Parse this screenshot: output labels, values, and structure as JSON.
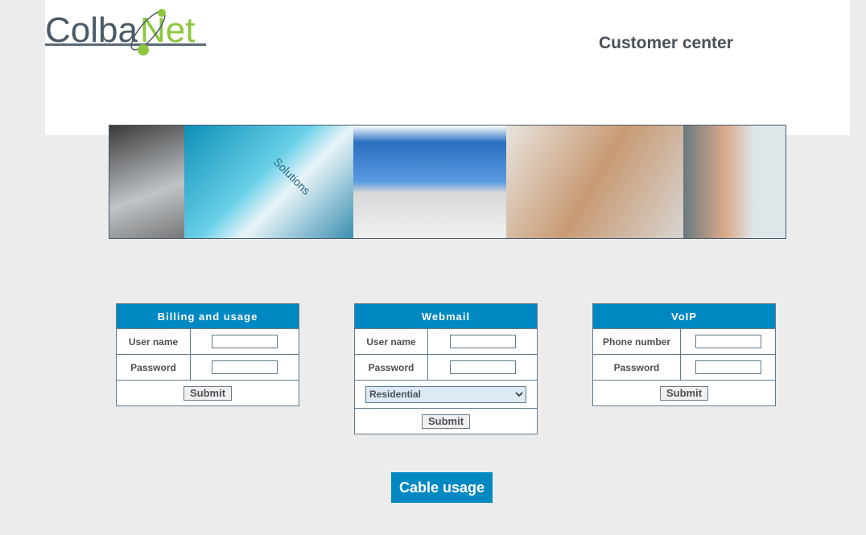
{
  "header": {
    "logo_text": "ColbaNet",
    "title": "Customer center"
  },
  "colors": {
    "accent": "#0088c2",
    "logo_gray": "#4a5a66",
    "logo_green": "#8cc63f"
  },
  "banner": {
    "segments": [
      "credit-card-laptop",
      "solutions-keyboard",
      "laptop-envelopes",
      "typing-hands",
      "woman-on-phone"
    ],
    "key_text": "Solutions"
  },
  "billing": {
    "title": "Billing and usage",
    "user_label": "User name",
    "password_label": "Password",
    "submit": "Submit"
  },
  "webmail": {
    "title": "Webmail",
    "user_label": "User name",
    "password_label": "Password",
    "account_type": "Residential",
    "submit": "Submit"
  },
  "voip": {
    "title": "VoIP",
    "phone_label": "Phone number",
    "password_label": "Password",
    "submit": "Submit"
  },
  "cable_usage": "Cable usage"
}
